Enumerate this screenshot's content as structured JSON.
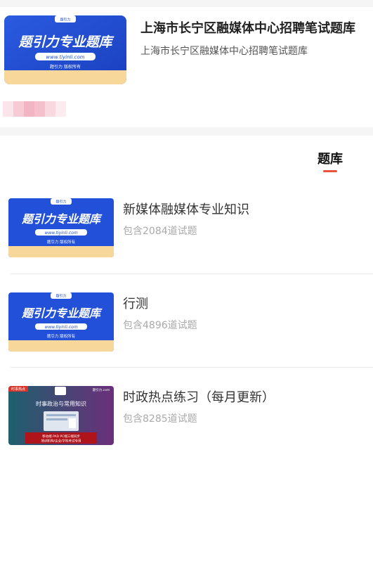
{
  "header": {
    "title": "上海市长宁区融媒体中心招聘笔试题库",
    "subtitle": "上海市长宁区融媒体中心招聘笔试题库",
    "cover": {
      "main_text": "题引力专业题库",
      "url_text": "www.tiyinli.com",
      "footer_text": "题引力 版权所有",
      "top_badge": "题引力"
    }
  },
  "tabs": [
    {
      "label": "题库",
      "active": true
    }
  ],
  "colors": {
    "accent": "#e8553b",
    "cover_blue": "#1f4fd6",
    "title_text": "#333333",
    "muted_text": "#aaaaaa"
  },
  "items": [
    {
      "title": "新媒体融媒体专业知识",
      "count": "包含2084道试题",
      "cover": {
        "main_text": "题引力专业题库",
        "url_text": "www.tiyinli.com",
        "footer_text": "题引力 版权所有",
        "top_badge": "题引力"
      }
    },
    {
      "title": "行测",
      "count": "包含4896道试题",
      "cover": {
        "main_text": "题引力专业题库",
        "url_text": "www.tiyinli.com",
        "footer_text": "题引力 版权所有",
        "top_badge": "题引力"
      }
    },
    {
      "title": "时政热点练习（每月更新）",
      "count": "包含8285道试题",
      "cover": {
        "corner_tag": "时事热点",
        "site_text": "题引力.com",
        "main_text": "时事政治与常用知识",
        "band_line1": "移动端  PAD  PC端三端同步",
        "band_line2": "培训机构/企业/学校考试专用"
      }
    }
  ]
}
